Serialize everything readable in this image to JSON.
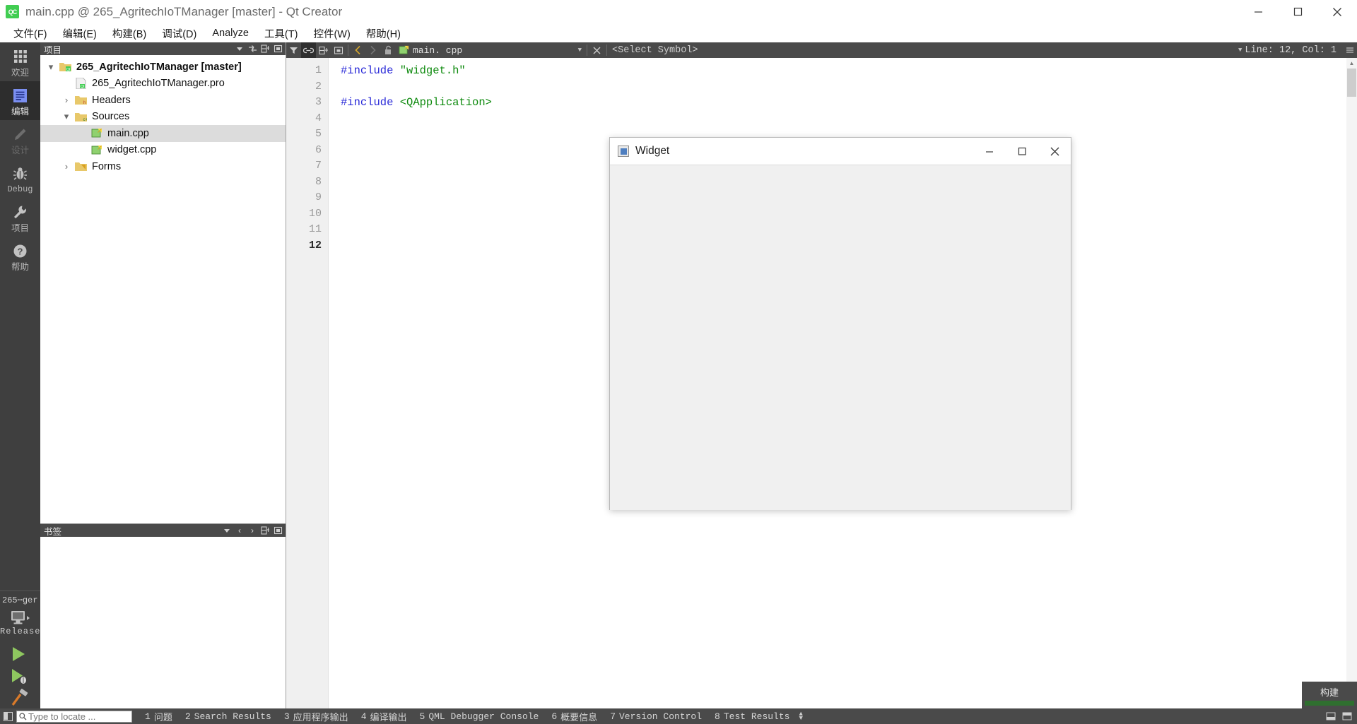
{
  "window": {
    "title": "main.cpp @ 265_AgritechIoTManager [master] - Qt Creator",
    "logo_text": "QC",
    "minimize": "─",
    "maximize": "☐",
    "close": "✕"
  },
  "menubar": {
    "items": [
      {
        "label": "文件(F)",
        "name": "menu-file"
      },
      {
        "label": "编辑(E)",
        "name": "menu-edit"
      },
      {
        "label": "构建(B)",
        "name": "menu-build"
      },
      {
        "label": "调试(D)",
        "name": "menu-debug"
      },
      {
        "label": "Analyze",
        "name": "menu-analyze"
      },
      {
        "label": "工具(T)",
        "name": "menu-tools"
      },
      {
        "label": "控件(W)",
        "name": "menu-widgets"
      },
      {
        "label": "帮助(H)",
        "name": "menu-help"
      }
    ]
  },
  "modebar": {
    "items": [
      {
        "label": "欢迎",
        "icon": "grid-icon",
        "active": false,
        "disabled": false
      },
      {
        "label": "编辑",
        "icon": "edit-icon",
        "active": true,
        "disabled": false
      },
      {
        "label": "设计",
        "icon": "pencil-icon",
        "active": false,
        "disabled": true
      },
      {
        "label": "Debug",
        "icon": "bug-icon",
        "active": false,
        "disabled": false
      },
      {
        "label": "项目",
        "icon": "wrench-icon",
        "active": false,
        "disabled": false
      },
      {
        "label": "帮助",
        "icon": "help-icon",
        "active": false,
        "disabled": false
      }
    ],
    "kit_name": "265⋯ger",
    "kit_config": "Release",
    "run_button": "run-icon",
    "debug_button": "run-debug-icon",
    "build_button": "hammer-icon"
  },
  "project_pane": {
    "title": "项目",
    "tools": [
      "filter-dropdown-icon",
      "sync-icon",
      "split-icon",
      "close-icon"
    ],
    "tree": [
      {
        "label": "265_AgritechIoTManager [master]",
        "icon": "qt-project-icon",
        "depth": 0,
        "expander": "down",
        "bold": true,
        "selected": false
      },
      {
        "label": "265_AgritechIoTManager.pro",
        "icon": "pro-file-icon",
        "depth": 1,
        "expander": "none",
        "bold": false,
        "selected": false
      },
      {
        "label": "Headers",
        "icon": "folder-h-icon",
        "depth": 1,
        "expander": "right",
        "bold": false,
        "selected": false
      },
      {
        "label": "Sources",
        "icon": "folder-cpp-icon",
        "depth": 1,
        "expander": "down",
        "bold": false,
        "selected": false
      },
      {
        "label": "main.cpp",
        "icon": "cpp-file-icon",
        "depth": 2,
        "expander": "none",
        "bold": false,
        "selected": true
      },
      {
        "label": "widget.cpp",
        "icon": "cpp-file-icon",
        "depth": 2,
        "expander": "none",
        "bold": false,
        "selected": false
      },
      {
        "label": "Forms",
        "icon": "folder-ui-icon",
        "depth": 1,
        "expander": "right",
        "bold": false,
        "selected": false
      }
    ]
  },
  "bookmarks_pane": {
    "title": "书签",
    "tools": [
      "dropdown-icon",
      "prev-icon",
      "next-icon",
      "split-icon",
      "close-icon"
    ]
  },
  "editor": {
    "toolbar_icons": [
      "filter-icon",
      "link-icon",
      "split-icon",
      "close-split-icon",
      "back-arrow-icon",
      "forward-arrow-icon",
      "unlock-icon"
    ],
    "file_icon": "cpp-file-icon",
    "file_name": "main. cpp",
    "symbol_placeholder": "<Select Symbol>",
    "line_col": "Line: 12, Col: 1",
    "line_numbers": [
      "1",
      "2",
      "3",
      "4",
      "5",
      "6",
      "7",
      "8",
      "9",
      "10",
      "11",
      "12"
    ],
    "current_line": 12,
    "lines": [
      {
        "n": 1,
        "segments": [
          {
            "t": "#include ",
            "c": "kw-pre"
          },
          {
            "t": "\"widget.h\"",
            "c": "str"
          }
        ]
      },
      {
        "n": 2,
        "segments": []
      },
      {
        "n": 3,
        "segments": [
          {
            "t": "#include ",
            "c": "kw-pre"
          },
          {
            "t": "<QApplication>",
            "c": "inc-angle"
          }
        ]
      },
      {
        "n": 4,
        "segments": []
      },
      {
        "n": 5,
        "segments": []
      },
      {
        "n": 6,
        "segments": []
      },
      {
        "n": 7,
        "segments": []
      },
      {
        "n": 8,
        "segments": []
      },
      {
        "n": 9,
        "segments": []
      },
      {
        "n": 10,
        "segments": []
      },
      {
        "n": 11,
        "segments": []
      },
      {
        "n": 12,
        "segments": []
      }
    ]
  },
  "widget_window": {
    "title": "Widget",
    "minimize": "─",
    "maximize": "☐",
    "close": "✕"
  },
  "build_popup": {
    "label": "构建",
    "progress": 100
  },
  "statusbar": {
    "locator_placeholder": "Type to locate ...",
    "locator_value": "",
    "outputs": [
      {
        "num": "1",
        "label": "问题",
        "name": "output-issues"
      },
      {
        "num": "2",
        "label": "Search Results",
        "name": "output-search-results"
      },
      {
        "num": "3",
        "label": "应用程序输出",
        "name": "output-application"
      },
      {
        "num": "4",
        "label": "编译输出",
        "name": "output-compile"
      },
      {
        "num": "5",
        "label": "QML Debugger Console",
        "name": "output-qml-debugger"
      },
      {
        "num": "6",
        "label": "概要信息",
        "name": "output-general"
      },
      {
        "num": "7",
        "label": "Version Control",
        "name": "output-version-control"
      },
      {
        "num": "8",
        "label": "Test Results",
        "name": "output-test-results"
      }
    ]
  },
  "colors": {
    "accent_green": "#41cd52",
    "dark_chrome": "#4a4a4a",
    "modebar": "#3f3f3f",
    "selection": "#dcdcdc",
    "keyword_blue": "#2b2bd8",
    "string_green": "#0e8a0e"
  }
}
